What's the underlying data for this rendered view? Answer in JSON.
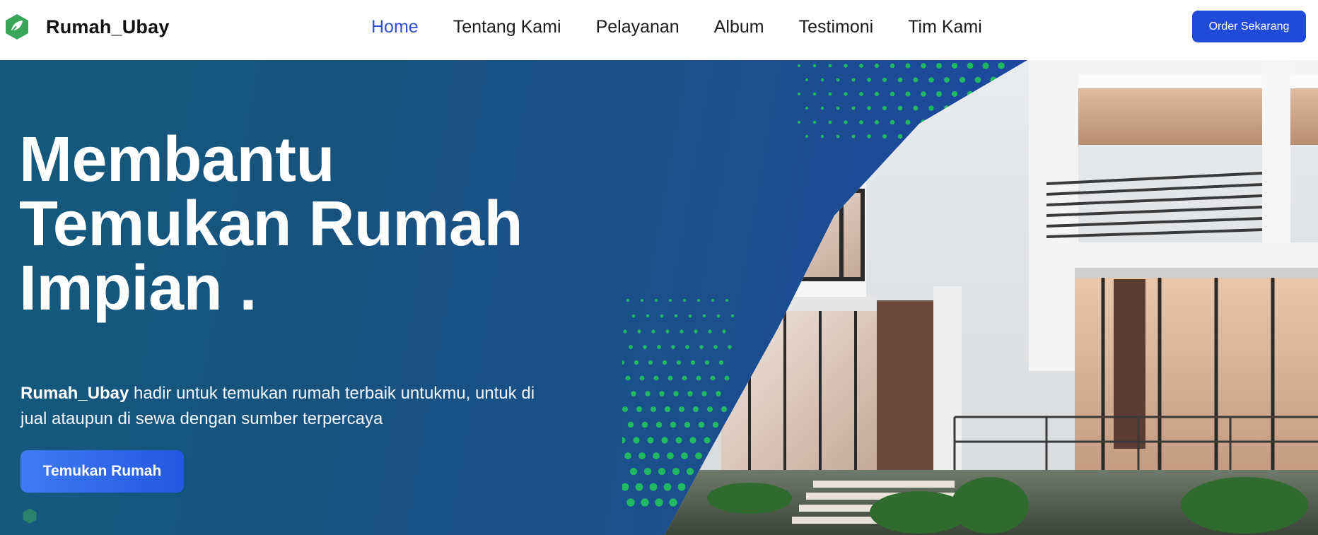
{
  "brand": {
    "name": "Rumah_Ubay",
    "logo_icon": "house-leaf-icon",
    "logo_color": "#3aa65a"
  },
  "nav": {
    "items": [
      {
        "label": "Home",
        "active": true
      },
      {
        "label": "Tentang Kami",
        "active": false
      },
      {
        "label": "Pelayanan",
        "active": false
      },
      {
        "label": "Album",
        "active": false
      },
      {
        "label": "Testimoni",
        "active": false
      },
      {
        "label": "Tim Kami",
        "active": false
      }
    ],
    "active_color": "#2f51d6"
  },
  "header": {
    "order_button": "Order Sekarang",
    "order_button_color": "#1f4bd8"
  },
  "hero": {
    "title_lines": [
      "Membantu",
      "Temukan Rumah",
      "Impian ."
    ],
    "description_brand": "Rumah_Ubay",
    "description_text": " hadir untuk temukan rumah terbaik untukmu, untuk di jual ataupun di sewa dengan sumber terpercaya",
    "cta_button": "Temukan Rumah",
    "background_colors": [
      "#145a7c",
      "#1f3fb3"
    ],
    "accent_dot_color": "#22c55e",
    "image": "modern-house-photo"
  }
}
